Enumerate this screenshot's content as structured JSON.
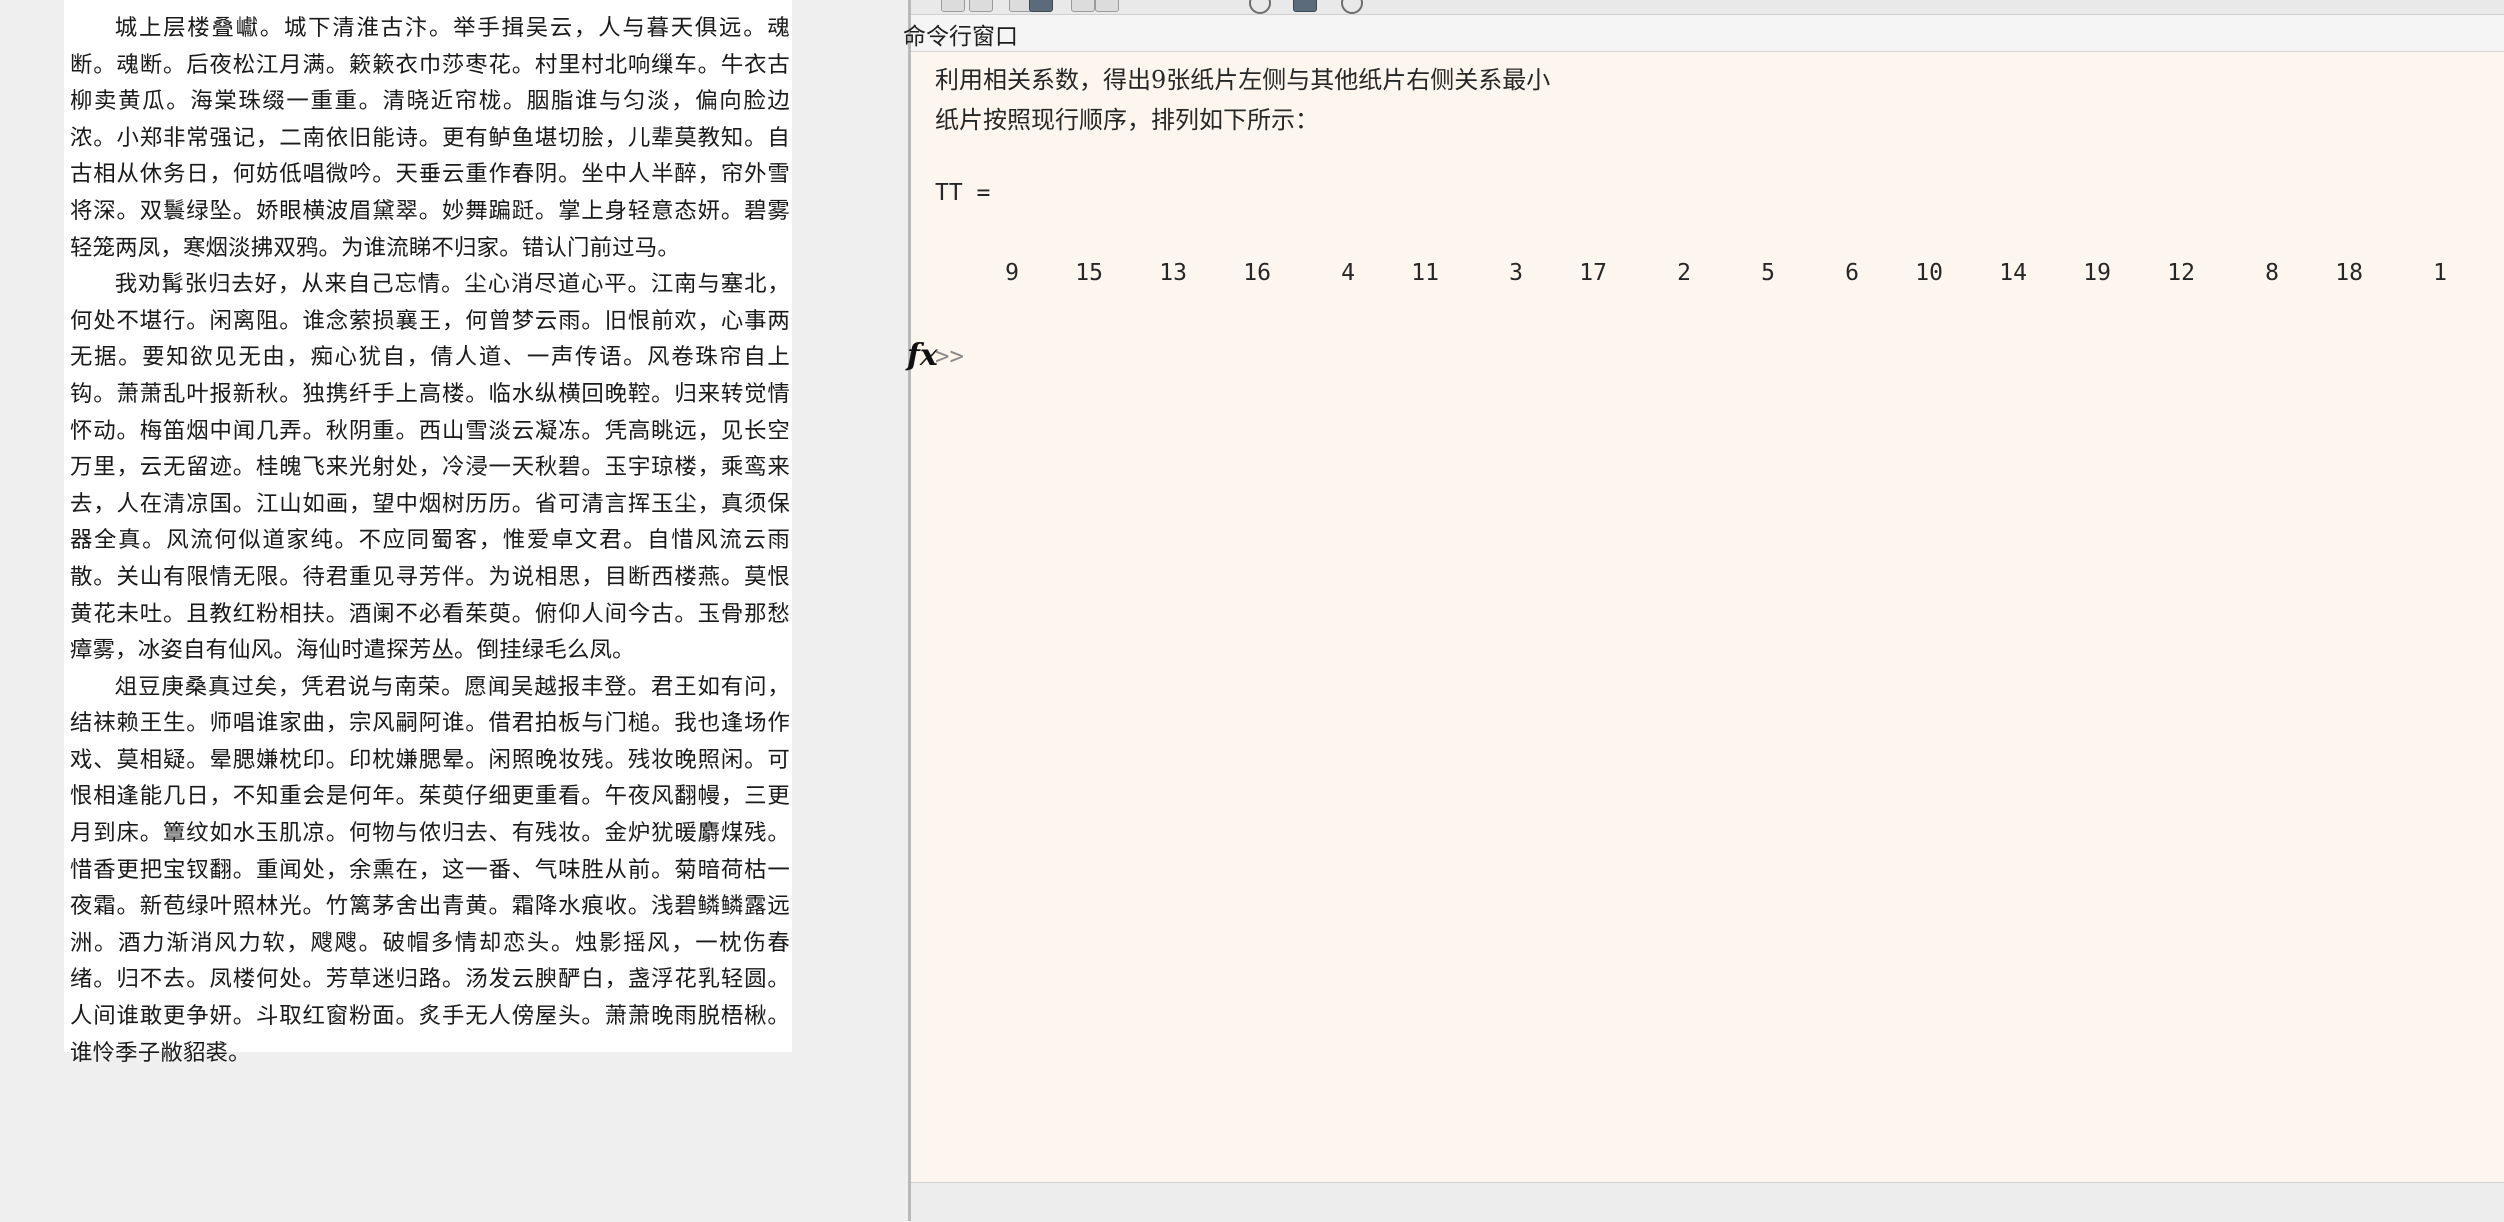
{
  "document": {
    "paragraphs": [
      "城上层楼叠巘。城下清淮古汴。举手揖吴云，人与暮天俱远。魂断。魂断。后夜松江月满。簌簌衣巾莎枣花。村里村北响缫车。牛衣古柳卖黄瓜。海棠珠缀一重重。清晓近帘栊。胭脂谁与匀淡，偏向脸边浓。小郑非常强记，二南依旧能诗。更有鲈鱼堪切脍，儿辈莫教知。自古相从休务日，何妨低唱微吟。天垂云重作春阴。坐中人半醉，帘外雪将深。双鬟绿坠。娇眼横波眉黛翠。妙舞蹁跹。掌上身轻意态妍。碧雾轻笼两凤，寒烟淡拂双鸦。为谁流睇不归家。错认门前过马。",
      "我劝髯张归去好，从来自己忘情。尘心消尽道心平。江南与塞北，何处不堪行。闲离阻。谁念萦损襄王，何曾梦云雨。旧恨前欢，心事两无据。要知欲见无由，痴心犹自，倩人道、一声传语。风卷珠帘自上钩。萧萧乱叶报新秋。独携纤手上高楼。临水纵横回晚鞚。归来转觉情怀动。梅笛烟中闻几弄。秋阴重。西山雪淡云凝冻。凭高眺远，见长空万里，云无留迹。桂魄飞来光射处，冷浸一天秋碧。玉宇琼楼，乘鸾来去，人在清凉国。江山如画，望中烟树历历。省可清言挥玉尘，真须保器全真。风流何似道家纯。不应同蜀客，惟爱卓文君。自惜风流云雨散。关山有限情无限。待君重见寻芳伴。为说相思，目断西楼燕。莫恨黄花未吐。且教红粉相扶。酒阑不必看茱萸。俯仰人间今古。玉骨那愁瘴雾，冰姿自有仙风。海仙时遣探芳丛。倒挂绿毛么凤。",
      "俎豆庚桑真过矣，凭君说与南荣。愿闻吴越报丰登。君王如有问，结袜赖王生。师唱谁家曲，宗风嗣阿谁。借君拍板与门槌。我也逢场作戏、莫相疑。晕腮嫌枕印。印枕嫌腮晕。闲照晚妆残。残妆晚照闲。可恨相逢能几日，不知重会是何年。茱萸仔细更重看。午夜风翻幔，三更月到床。簟纹如水玉肌凉。何物与侬归去、有残妆。金炉犹暖麝煤残。惜香更把宝钗翻。重闻处，余熏在，这一番、气味胜从前。菊暗荷枯一夜霜。新苞绿叶照林光。竹篱茅舍出青黄。霜降水痕收。浅碧鳞鳞露远洲。酒力渐消风力软，飕飕。破帽多情却恋头。烛影摇风，一枕伤春绪。归不去。凤楼何处。芳草迷归路。汤发云腴酽白，盏浮花乳轻圆。人间谁敢更争妍。斗取红窗粉面。炙手无人傍屋头。萧萧晚雨脱梧楸。谁怜季子敝貂裘。"
    ]
  },
  "command_window": {
    "title": "命令行窗口",
    "output_lines": [
      "利用相关系数，得出9张纸片左侧与其他纸片右侧关系最小",
      "纸片按照现行顺序，排列如下所示："
    ],
    "variable_label": "TT =",
    "result_values": [
      "9",
      "15",
      "13",
      "16",
      "4",
      "11",
      "3",
      "17",
      "2",
      "5",
      "6",
      "10",
      "14",
      "19",
      "12",
      "8",
      "18",
      "1"
    ],
    "fx_symbol": "fx",
    "prompt": ">>"
  },
  "toolbar": {
    "icons": [
      "new-file-icon",
      "open-icon",
      "copy-icon",
      "paste-icon",
      "undo-icon",
      "redo-icon",
      "find-icon",
      "workspace-icon",
      "help-icon"
    ]
  }
}
